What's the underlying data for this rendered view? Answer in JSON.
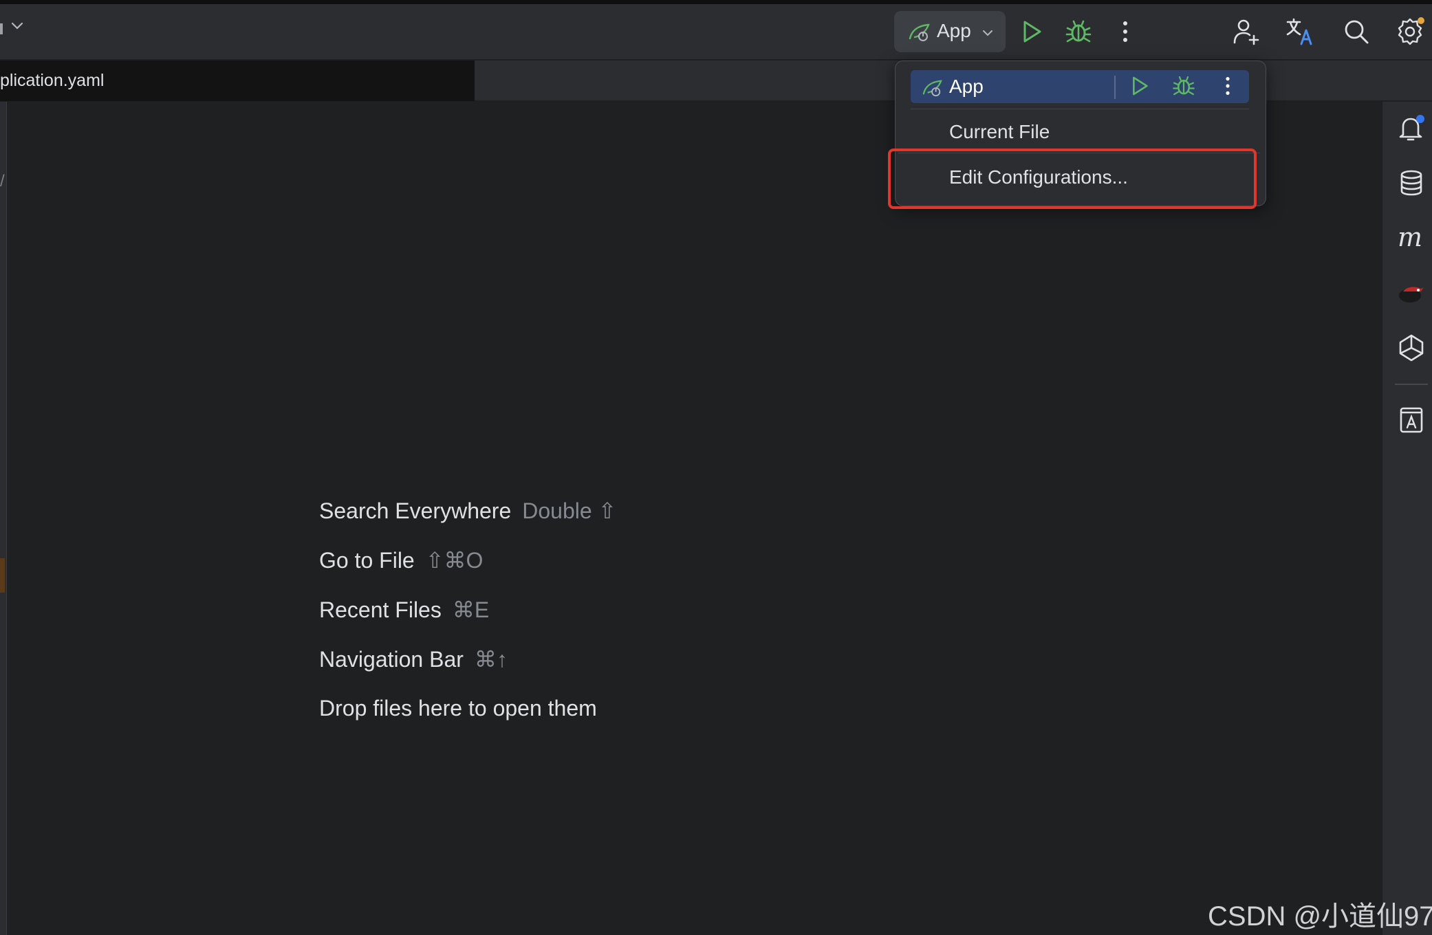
{
  "colors": {
    "run_green": "#5fb865",
    "debug_green": "#5fb865",
    "selection_blue": "#2e436e",
    "highlight_red": "#e0362c",
    "notification_dot": "#3574f0",
    "settings_dot": "#e5a53a"
  },
  "toolbar": {
    "run_config_label": "App",
    "icons": [
      "run-config-icon",
      "chevron-down-icon",
      "run-icon",
      "debug-icon",
      "more-vertical-icon",
      "add-user-icon",
      "translate-icon",
      "search-icon",
      "settings-icon"
    ]
  },
  "tabs": {
    "active_tab_label": "plication.yaml"
  },
  "popup": {
    "selected_label": "App",
    "items": [
      "Current File",
      "Edit Configurations..."
    ]
  },
  "editor_hints": [
    {
      "label": "Search Everywhere",
      "shortcut": "Double ⇧"
    },
    {
      "label": "Go to File",
      "shortcut": "⇧⌘O"
    },
    {
      "label": "Recent Files",
      "shortcut": "⌘E"
    },
    {
      "label": "Navigation Bar",
      "shortcut": "⌘↑"
    },
    {
      "label": "Drop files here to open them",
      "shortcut": ""
    }
  ],
  "right_strip_icons": [
    "notifications-icon",
    "database-icon",
    "maven-icon",
    "plugin-bird-icon",
    "ai-assistant-icon",
    "translation-file-icon"
  ],
  "watermark": "CSDN @小道仙97"
}
